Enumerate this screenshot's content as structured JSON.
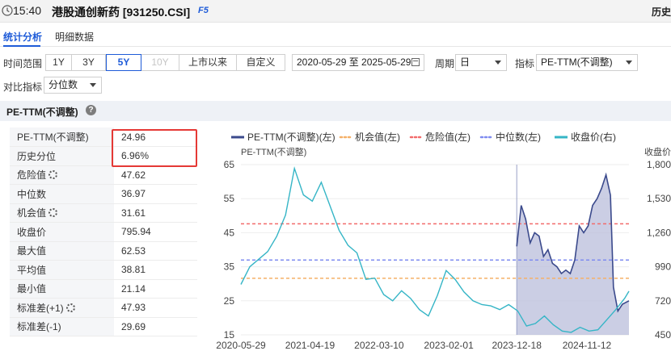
{
  "header": {
    "time": "15:40",
    "title": "港股通创新药 [931250.CSI]",
    "hotkey": "F5",
    "history": "历史"
  },
  "tabs": [
    {
      "label": "统计分析"
    },
    {
      "label": "明细数据"
    }
  ],
  "controls": {
    "range_label": "时间范围",
    "range_buttons": [
      "1Y",
      "3Y",
      "5Y",
      "10Y",
      "上市以来",
      "自定义"
    ],
    "active_range": "5Y",
    "date_range": "2020-05-29 至 2025-05-29",
    "period_label": "周期",
    "period_value": "日",
    "indicator_label": "指标",
    "indicator_value": "PE-TTM(不调整)",
    "compare_label": "对比指标",
    "compare_value": "分位数"
  },
  "section": {
    "title": "PE-TTM(不调整)",
    "help_icon": "question-circle-icon"
  },
  "stats": [
    {
      "key": "PE-TTM(不调整)",
      "value": "24.96",
      "gear": false
    },
    {
      "key": "历史分位",
      "value": "6.96%",
      "gear": false
    },
    {
      "key": "危险值",
      "value": "47.62",
      "gear": true
    },
    {
      "key": "中位数",
      "value": "36.97",
      "gear": false
    },
    {
      "key": "机会值",
      "value": "31.61",
      "gear": true
    },
    {
      "key": "收盘价",
      "value": "795.94",
      "gear": false
    },
    {
      "key": "最大值",
      "value": "62.53",
      "gear": false
    },
    {
      "key": "平均值",
      "value": "38.81",
      "gear": false
    },
    {
      "key": "最小值",
      "value": "21.14",
      "gear": false
    },
    {
      "key": "标准差(+1)",
      "value": "47.93",
      "gear": true
    },
    {
      "key": "标准差(-1)",
      "value": "29.69",
      "gear": false
    }
  ],
  "colors": {
    "accent": "#1e5bd8",
    "pe": "#3b4a8c",
    "close": "#35b5c6",
    "danger": "#f26b6b",
    "median": "#7f8cf0",
    "opportunity": "#f5b068",
    "highlight": "#e53935"
  },
  "chart_data": {
    "type": "line",
    "legend": [
      "PE-TTM(不调整)(左)",
      "机会值(左)",
      "危险值(左)",
      "中位数(左)",
      "收盘价(右)"
    ],
    "left_axis_title": "PE-TTM(不调整)",
    "right_axis_title": "收盘价",
    "left_ticks": [
      65,
      55,
      45,
      35,
      25,
      15
    ],
    "right_ticks": [
      "1,800",
      "1,530",
      "1,260",
      "990",
      "720",
      "450"
    ],
    "x_ticks": [
      "2020-05-29",
      "2021-04-19",
      "2022-03-10",
      "2023-02-01",
      "2023-12-18",
      "2024-11-12"
    ],
    "ylim_left": [
      15,
      65
    ],
    "ylim_right": [
      450,
      1800
    ],
    "reference_lines": {
      "danger": 47.62,
      "median": 36.97,
      "opportunity": 31.61
    },
    "pe_start_date": "2023-12-18",
    "pe_series": [
      {
        "date": "2023-12-18",
        "value": 41
      },
      {
        "date": "2024-01-08",
        "value": 53
      },
      {
        "date": "2024-01-29",
        "value": 49
      },
      {
        "date": "2024-02-19",
        "value": 42
      },
      {
        "date": "2024-03-11",
        "value": 45
      },
      {
        "date": "2024-04-01",
        "value": 44
      },
      {
        "date": "2024-04-22",
        "value": 38
      },
      {
        "date": "2024-05-13",
        "value": 40
      },
      {
        "date": "2024-06-03",
        "value": 36
      },
      {
        "date": "2024-06-24",
        "value": 35
      },
      {
        "date": "2024-07-15",
        "value": 33
      },
      {
        "date": "2024-08-05",
        "value": 34
      },
      {
        "date": "2024-08-26",
        "value": 33
      },
      {
        "date": "2024-09-16",
        "value": 37
      },
      {
        "date": "2024-10-07",
        "value": 47
      },
      {
        "date": "2024-10-28",
        "value": 45
      },
      {
        "date": "2024-11-18",
        "value": 47
      },
      {
        "date": "2024-12-09",
        "value": 53
      },
      {
        "date": "2024-12-30",
        "value": 55
      },
      {
        "date": "2025-01-20",
        "value": 58
      },
      {
        "date": "2025-02-10",
        "value": 62
      },
      {
        "date": "2025-03-03",
        "value": 56
      },
      {
        "date": "2025-03-17",
        "value": 29
      },
      {
        "date": "2025-04-07",
        "value": 22
      },
      {
        "date": "2025-04-28",
        "value": 24
      },
      {
        "date": "2025-05-29",
        "value": 25
      }
    ],
    "close_series": [
      {
        "date": "2020-05-29",
        "value": 850
      },
      {
        "date": "2020-07-10",
        "value": 990
      },
      {
        "date": "2020-08-21",
        "value": 1050
      },
      {
        "date": "2020-10-02",
        "value": 1110
      },
      {
        "date": "2020-11-13",
        "value": 1230
      },
      {
        "date": "2020-12-25",
        "value": 1400
      },
      {
        "date": "2021-02-05",
        "value": 1770
      },
      {
        "date": "2021-03-19",
        "value": 1560
      },
      {
        "date": "2021-04-30",
        "value": 1510
      },
      {
        "date": "2021-06-11",
        "value": 1660
      },
      {
        "date": "2021-07-23",
        "value": 1470
      },
      {
        "date": "2021-09-03",
        "value": 1280
      },
      {
        "date": "2021-10-15",
        "value": 1160
      },
      {
        "date": "2021-11-26",
        "value": 1100
      },
      {
        "date": "2022-01-07",
        "value": 890
      },
      {
        "date": "2022-02-18",
        "value": 900
      },
      {
        "date": "2022-04-01",
        "value": 770
      },
      {
        "date": "2022-05-13",
        "value": 720
      },
      {
        "date": "2022-06-24",
        "value": 800
      },
      {
        "date": "2022-08-05",
        "value": 740
      },
      {
        "date": "2022-09-16",
        "value": 650
      },
      {
        "date": "2022-10-28",
        "value": 600
      },
      {
        "date": "2022-12-09",
        "value": 760
      },
      {
        "date": "2023-01-20",
        "value": 960
      },
      {
        "date": "2023-03-03",
        "value": 890
      },
      {
        "date": "2023-04-14",
        "value": 790
      },
      {
        "date": "2023-05-26",
        "value": 720
      },
      {
        "date": "2023-07-07",
        "value": 690
      },
      {
        "date": "2023-08-18",
        "value": 680
      },
      {
        "date": "2023-09-29",
        "value": 650
      },
      {
        "date": "2023-11-10",
        "value": 690
      },
      {
        "date": "2023-12-22",
        "value": 640
      },
      {
        "date": "2024-02-02",
        "value": 520
      },
      {
        "date": "2024-03-15",
        "value": 540
      },
      {
        "date": "2024-04-26",
        "value": 600
      },
      {
        "date": "2024-06-07",
        "value": 530
      },
      {
        "date": "2024-07-19",
        "value": 480
      },
      {
        "date": "2024-08-30",
        "value": 470
      },
      {
        "date": "2024-10-11",
        "value": 510
      },
      {
        "date": "2024-11-22",
        "value": 480
      },
      {
        "date": "2025-01-03",
        "value": 490
      },
      {
        "date": "2025-02-14",
        "value": 570
      },
      {
        "date": "2025-03-28",
        "value": 650
      },
      {
        "date": "2025-05-09",
        "value": 740
      },
      {
        "date": "2025-05-29",
        "value": 796
      }
    ]
  }
}
